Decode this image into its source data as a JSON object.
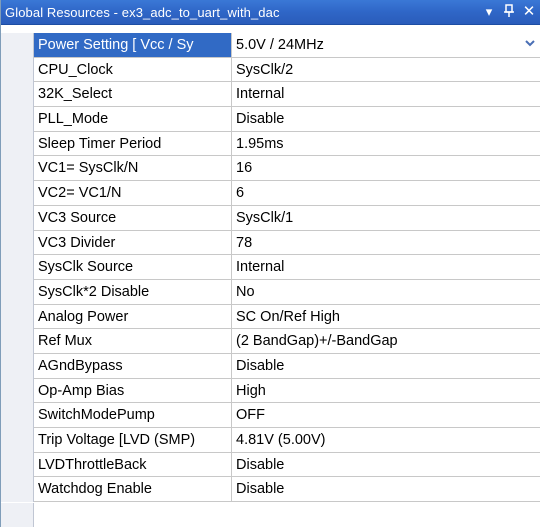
{
  "window": {
    "title": "Global Resources - ex3_adc_to_uart_with_dac",
    "dropdown_icon": "chevron-down-icon",
    "pin_icon": "pin-icon",
    "close_icon": "close-icon",
    "dropdown_glyph": "▾",
    "pin_glyph": "ᅡ",
    "close_glyph": "✕"
  },
  "colors": {
    "title_bar": "#2f66c7",
    "selection": "#316ac5",
    "margin": "#eef0f5",
    "grid_line": "#c8c8c8"
  },
  "properties": [
    {
      "name": "Power Setting [ Vcc / Sy",
      "value": "5.0V / 24MHz",
      "selected": true,
      "has_dropdown": true
    },
    {
      "name": "CPU_Clock",
      "value": "SysClk/2"
    },
    {
      "name": "32K_Select",
      "value": "Internal"
    },
    {
      "name": "PLL_Mode",
      "value": "Disable"
    },
    {
      "name": "Sleep Timer Period",
      "value": "1.95ms"
    },
    {
      "name": "VC1= SysClk/N",
      "value": "16"
    },
    {
      "name": "VC2= VC1/N",
      "value": "6"
    },
    {
      "name": "VC3 Source",
      "value": "SysClk/1"
    },
    {
      "name": "VC3 Divider",
      "value": "78"
    },
    {
      "name": "SysClk Source",
      "value": "Internal"
    },
    {
      "name": "SysClk*2 Disable",
      "value": "No"
    },
    {
      "name": "Analog Power",
      "value": "SC On/Ref High"
    },
    {
      "name": "Ref Mux",
      "value": "(2 BandGap)+/-BandGap"
    },
    {
      "name": "AGndBypass",
      "value": "Disable"
    },
    {
      "name": "Op-Amp Bias",
      "value": "High"
    },
    {
      "name": "SwitchModePump",
      "value": "OFF"
    },
    {
      "name": "Trip Voltage [LVD (SMP)",
      "value": "4.81V (5.00V)"
    },
    {
      "name": "LVDThrottleBack",
      "value": "Disable"
    },
    {
      "name": "Watchdog Enable",
      "value": "Disable"
    }
  ]
}
